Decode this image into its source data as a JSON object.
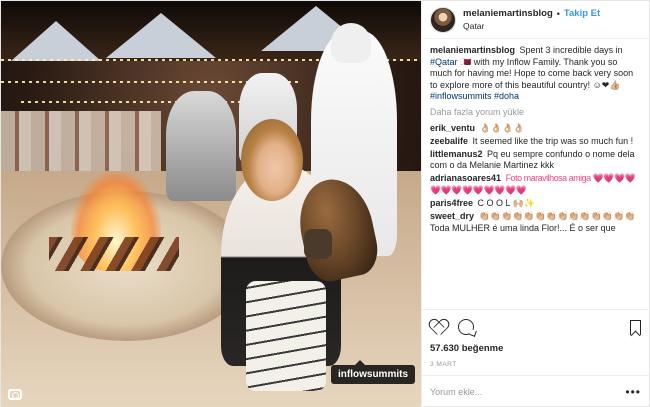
{
  "header": {
    "username": "melaniemartinsblog",
    "follow_label": "Takip Et",
    "separator": "•",
    "location": "Qatar"
  },
  "caption": {
    "username": "melaniemartinsblog",
    "text_before": " Spent 3 incredible days in ",
    "hashtag_qatar": "#Qatar",
    "text_after": " 🇶🇦 with my Inflow Family. Thank you so much for having me! Hope to come back very soon to explore more of this beautiful country! ☺❤👍🏼 ",
    "hashtags": "#inflowsummits #doha"
  },
  "load_more": "Daha fazla yorum yükle",
  "comments": [
    {
      "user": "erik_ventu",
      "text": "👌🏼👌🏼👌🏼👌🏼"
    },
    {
      "user": "zeebalife",
      "text": "It seemed like the trip was so much fun !"
    },
    {
      "user": "littlemanus2",
      "text": "Pq eu sempre confundo o nome dela com o da Melanie Martinez kkk"
    },
    {
      "user": "adrianasoares41",
      "text": "Foto maravilhosa amiga 💗💗💗💗💗💗💗💗💗💗💗💗💗"
    },
    {
      "user": "paris4free",
      "text": "C O O L 🙌🏼✨"
    },
    {
      "user": "sweet_dry",
      "text": "👏🏼👏🏼👏🏼👏🏼👏🏼👏🏼👏🏼👏🏼👏🏼👏🏼👏🏼👏🏼👏🏼👏🏼 Toda MULHER é uma linda Flor!... É o ser que"
    }
  ],
  "likes": "57.630 beğenme",
  "date": "3 MART",
  "add_comment_placeholder": "Yorum ekle...",
  "more_label": "•••",
  "photo": {
    "tag_label": "inflowsummits"
  },
  "icons": {
    "like": "heart-icon",
    "comment": "comment-bubble-icon",
    "save": "bookmark-icon",
    "tagged": "user-tag-icon"
  },
  "colors": {
    "follow_blue": "#3897f0",
    "hashtag_blue": "#003569",
    "muted_gray": "#999999"
  }
}
